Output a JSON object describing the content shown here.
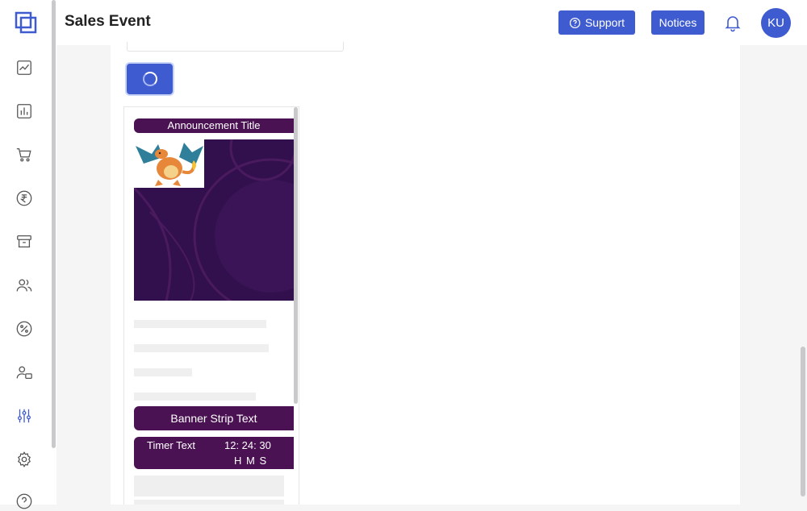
{
  "header": {
    "title": "Sales Event",
    "support_label": "Support",
    "notices_label": "Notices",
    "avatar_initials": "KU"
  },
  "sidebar": {
    "items": [
      {
        "icon": "trend-chart-icon"
      },
      {
        "icon": "bar-chart-icon"
      },
      {
        "icon": "cart-icon"
      },
      {
        "icon": "rupee-icon"
      },
      {
        "icon": "archive-icon"
      },
      {
        "icon": "users-icon"
      },
      {
        "icon": "percent-icon"
      },
      {
        "icon": "user-card-icon"
      },
      {
        "icon": "sliders-icon",
        "active": true
      },
      {
        "icon": "gear-icon"
      },
      {
        "icon": "help-icon"
      }
    ]
  },
  "preview": {
    "announcement_title": "Announcement Title",
    "banner_strip_text": "Banner Strip Text",
    "timer_text": "Timer Text",
    "timer_value": "12: 24: 30",
    "timer_units": "H M S"
  },
  "colors": {
    "accent": "#3f5bd0",
    "banner_bg": "#4a1252",
    "banner_image_bg": "#32104d"
  }
}
